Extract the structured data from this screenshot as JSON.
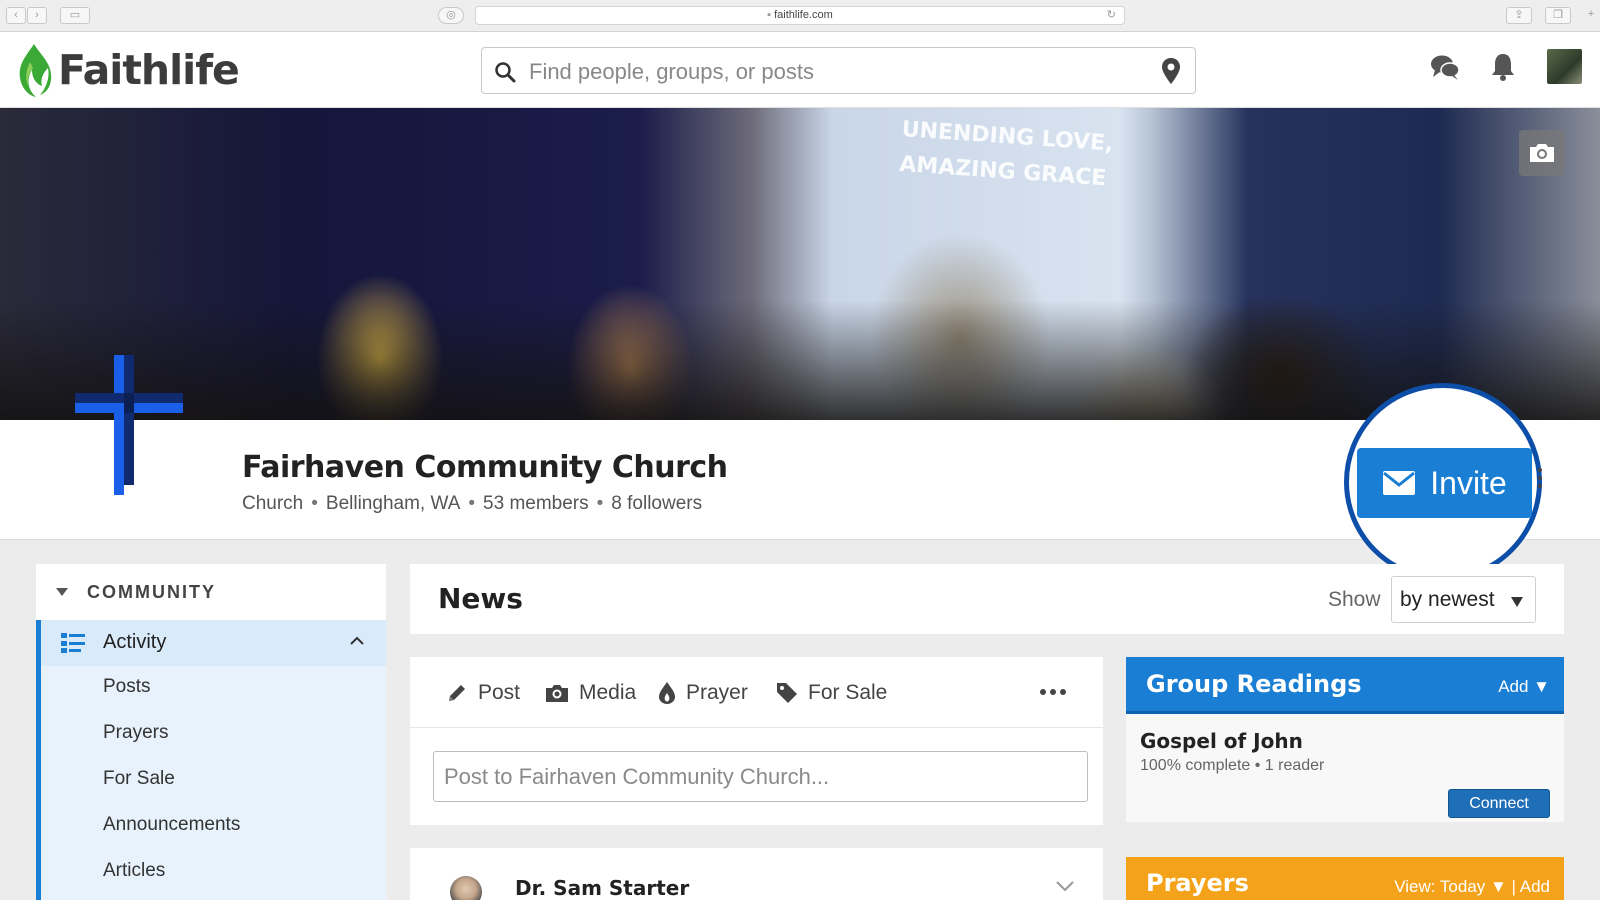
{
  "browser": {
    "url": "faithlife.com"
  },
  "brand": {
    "name": "Faithlife",
    "green": "#3aa935",
    "blue": "#1a7fd4",
    "orange": "#f5a21b"
  },
  "search": {
    "placeholder": "Find people, groups, or posts"
  },
  "banner": {
    "screen_line1": "UNENDING LOVE,",
    "screen_line2": "AMAZING GRACE"
  },
  "group": {
    "name": "Fairhaven Community Church",
    "type": "Church",
    "location": "Bellingham, WA",
    "members": "53 members",
    "followers": "8 followers",
    "invite_label": "Invite"
  },
  "sidebar": {
    "section": "COMMUNITY",
    "active": "Activity",
    "items": [
      "Posts",
      "Prayers",
      "For Sale",
      "Announcements",
      "Articles"
    ]
  },
  "news": {
    "title": "News",
    "show_label": "Show",
    "sort_value": "by newest"
  },
  "composer": {
    "tabs": [
      "Post",
      "Media",
      "Prayer",
      "For Sale"
    ],
    "placeholder": "Post to Fairhaven Community Church..."
  },
  "feed": {
    "first_author": "Dr. Sam Starter"
  },
  "group_readings": {
    "title": "Group Readings",
    "add_label": "Add ▼",
    "reading_title": "Gospel of John",
    "reading_meta": "100% complete • 1 reader",
    "connect_label": "Connect"
  },
  "prayers": {
    "title": "Prayers",
    "right_label": "View: Today ▼ | Add"
  },
  "icons": [
    "search-icon",
    "location-pin-icon",
    "chat-icon",
    "bell-icon",
    "camera-icon",
    "envelope-icon",
    "list-icon",
    "chevron-up-icon",
    "pencil-icon",
    "flame-icon",
    "tag-icon",
    "more-icon",
    "chevron-down-icon"
  ]
}
